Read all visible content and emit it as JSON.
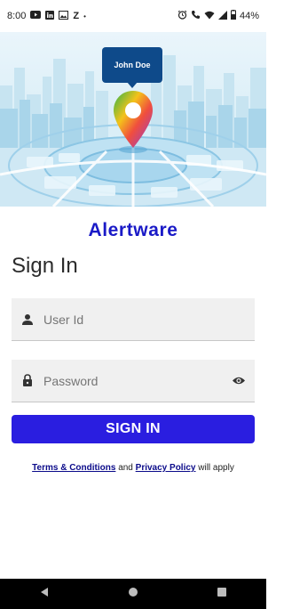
{
  "status_bar": {
    "time": "8:00",
    "left_icons": [
      "youtube-icon",
      "linkedin-icon",
      "gallery-icon",
      "z-icon",
      "dot-icon"
    ],
    "z_label": "Z",
    "battery": "44%",
    "right_icons": [
      "alarm-icon",
      "call-icon",
      "wifi-icon",
      "signal-icon",
      "battery-icon"
    ]
  },
  "hero": {
    "marker_label": "John Doe",
    "pin_icon": "location-pin-icon"
  },
  "app_name": "Alertware",
  "title": "Sign In",
  "userid": {
    "placeholder": "User Id",
    "icon": "person-icon"
  },
  "password": {
    "placeholder": "Password",
    "icon": "lock-icon",
    "toggle_icon": "eye-icon"
  },
  "signin_button": "SIGN IN",
  "terms": {
    "link1": "Terms & Conditions",
    "and": "and",
    "link2": "Privacy Policy",
    "suffix": "will apply"
  },
  "nav": {
    "back_icon": "back-icon",
    "home_icon": "home-icon",
    "recents_icon": "recents-icon"
  },
  "colors": {
    "accent": "#2a1ee0",
    "app_name": "#1a1ac7",
    "link": "#0b0b8a"
  }
}
